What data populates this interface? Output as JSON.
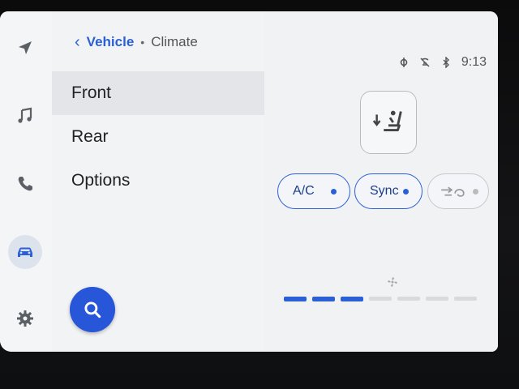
{
  "breadcrumb": {
    "back": "‹",
    "parent": "Vehicle",
    "separator": "•",
    "current": "Climate"
  },
  "nav": {
    "items": [
      {
        "icon": "navigation-arrow-icon"
      },
      {
        "icon": "music-note-icon"
      },
      {
        "icon": "phone-icon"
      },
      {
        "icon": "car-icon",
        "active": true
      },
      {
        "icon": "gear-icon"
      }
    ]
  },
  "menu": {
    "front": "Front",
    "rear": "Rear",
    "options": "Options",
    "selected": "Front"
  },
  "search": {
    "icon": "search-icon"
  },
  "status": {
    "time": "9:13",
    "icons": [
      "signal-icon",
      "no-phone-icon",
      "bluetooth-icon"
    ]
  },
  "climate": {
    "seat_mode_icon": "seat-airflow-icon",
    "ac": {
      "label": "A/C",
      "on": true
    },
    "sync": {
      "label": "Sync",
      "on": true
    },
    "recirc": {
      "icon": "recirculation-icon",
      "on": false
    },
    "fan": {
      "icon": "fan-icon",
      "level": 3,
      "max": 7
    },
    "accent_color": "#2a5fd6"
  }
}
